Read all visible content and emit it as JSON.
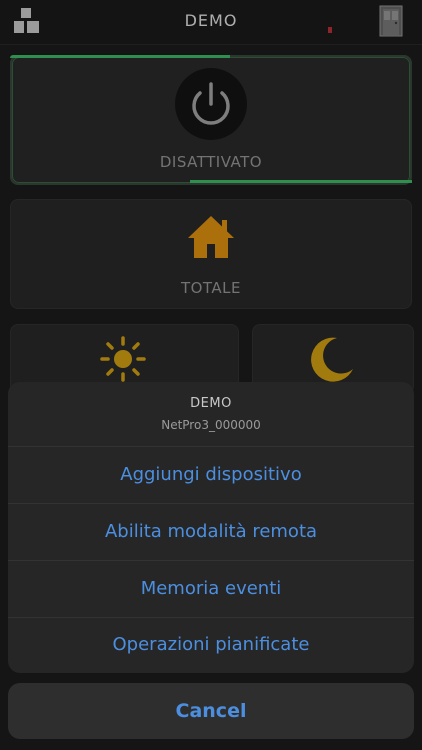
{
  "header": {
    "title": "DEMO",
    "menu_icon": "grid-blocks-icon",
    "door_icon": "door-icon"
  },
  "status_card": {
    "label": "DISATTIVATO",
    "icon": "power-icon"
  },
  "totale_card": {
    "label": "TOTALE",
    "icon": "home-icon"
  },
  "mode_cards": {
    "day_icon": "sun-icon",
    "night_icon": "moon-icon"
  },
  "action_sheet": {
    "title": "DEMO",
    "subtitle": "NetPro3_000000",
    "items": [
      {
        "label": "Aggiungi dispositivo"
      },
      {
        "label": "Abilita modalità remota"
      },
      {
        "label": "Memoria eventi"
      },
      {
        "label": "Operazioni pianificate"
      }
    ],
    "cancel_label": "Cancel"
  },
  "colors": {
    "accent_blue": "#4c8fe0",
    "accent_green": "#3fbf6a",
    "icon_gold": "#d9a514",
    "icon_orange": "#e5950f"
  }
}
